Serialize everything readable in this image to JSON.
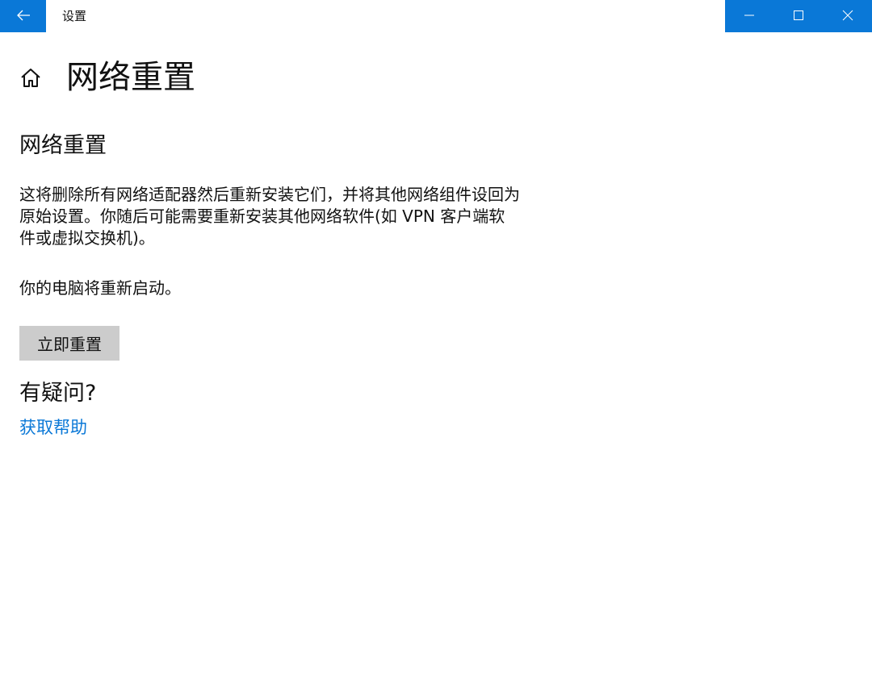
{
  "window": {
    "title": "设置",
    "accent_color": "#0a78d7",
    "icons": {
      "back": "back-arrow-icon",
      "minimize": "minimize-icon",
      "maximize": "maximize-icon",
      "close": "close-icon",
      "home": "home-icon"
    }
  },
  "page": {
    "title": "网络重置"
  },
  "content": {
    "section_title": "网络重置",
    "description": "这将删除所有网络适配器然后重新安装它们，并将其他网络组件设回为原始设置。你随后可能需要重新安装其他网络软件(如 VPN 客户端软件或虚拟交换机)。",
    "restart_note": "你的电脑将重新启动。",
    "reset_button_label": "立即重置"
  },
  "help": {
    "title": "有疑问?",
    "link_label": "获取帮助"
  }
}
